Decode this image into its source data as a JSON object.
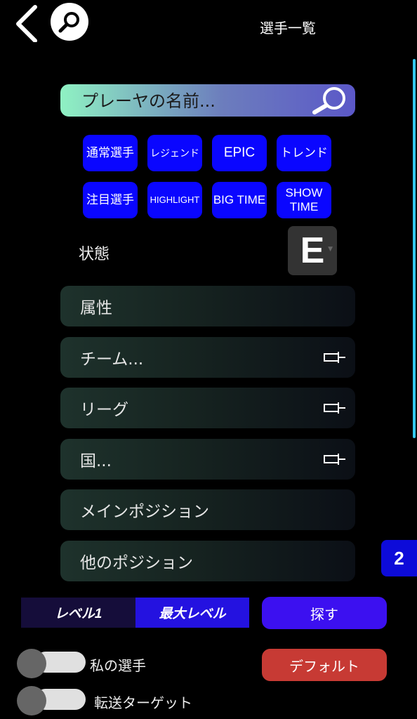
{
  "header": {
    "title": "選手一覧",
    "back_icon": "chevron-left-icon",
    "search_icon": "magnifier-icon"
  },
  "search": {
    "placeholder": "プレーヤの名前...",
    "icon": "magnifier-icon"
  },
  "chips": [
    {
      "label": "通常選手"
    },
    {
      "label": "レジェンド"
    },
    {
      "label": "EPIC"
    },
    {
      "label": "トレンド"
    },
    {
      "label": "注目選手"
    },
    {
      "label": "HIGHLIGHT"
    },
    {
      "label": "BIG TIME"
    },
    {
      "label": "SHOW TIME"
    }
  ],
  "state": {
    "label": "状態",
    "value": "E"
  },
  "rows": [
    {
      "label": "属性",
      "pin": false
    },
    {
      "label": "チーム...",
      "pin": true
    },
    {
      "label": "リーグ",
      "pin": true
    },
    {
      "label": "国...",
      "pin": true
    },
    {
      "label": "メインポジション",
      "pin": false
    },
    {
      "label": "他のポジション",
      "pin": false
    }
  ],
  "page_badge": "2",
  "level": {
    "min_label": "レベル1",
    "max_label": "最大レベル"
  },
  "buttons": {
    "search": "探す",
    "default": "デフォルト"
  },
  "toggles": [
    {
      "label": "私の選手",
      "on": false
    },
    {
      "label": "転送ターゲット",
      "on": false
    }
  ],
  "colors": {
    "chip": "#0a06ff",
    "search_button": "#3c10f0",
    "default_button": "#c73a34",
    "scrollbar": "#32c9f0"
  }
}
